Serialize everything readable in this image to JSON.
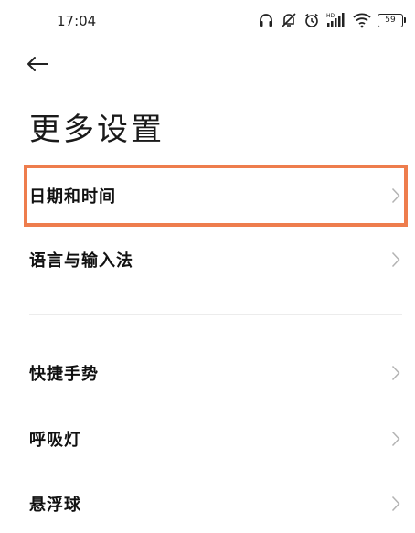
{
  "status_bar": {
    "time": "17:04",
    "battery": "59",
    "icons": [
      "headphones-icon",
      "mute-notifications-icon",
      "alarm-icon",
      "hd-signal-icon",
      "wifi-icon",
      "battery-icon"
    ]
  },
  "header": {
    "back_icon": "back-arrow-icon",
    "title": "更多设置"
  },
  "settings": {
    "items": [
      {
        "label": "日期和时间",
        "highlighted": true
      },
      {
        "label": "语言与输入法"
      },
      {
        "label": "快捷手势"
      },
      {
        "label": "呼吸灯"
      },
      {
        "label": "悬浮球"
      }
    ]
  },
  "colors": {
    "highlight": "#ee7d4d",
    "chevron": "#b3b3b3",
    "divider": "#ececec"
  }
}
